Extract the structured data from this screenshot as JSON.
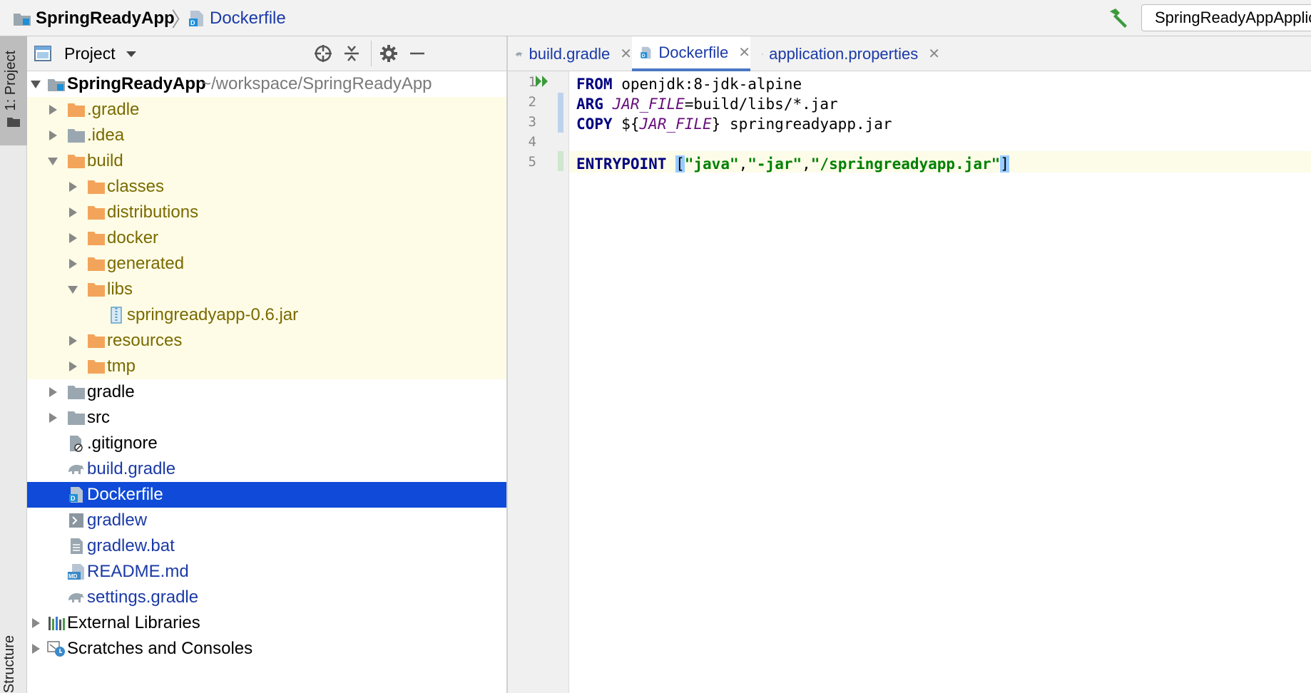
{
  "breadcrumb": {
    "project": "SpringReadyApp",
    "separator": "〉",
    "file": "Dockerfile"
  },
  "run_config": {
    "label": "SpringReadyAppApplication"
  },
  "left_stripe": {
    "project_tab": "1: Project",
    "bottom_tab": "Structure"
  },
  "project_panel": {
    "title": "Project",
    "icons": [
      "target-icon",
      "collapse-icon",
      "gear-icon",
      "minimize-icon"
    ]
  },
  "tree": {
    "root_name": "SpringReadyApp",
    "root_path": "~/workspace/SpringReadyApp",
    "items": [
      {
        "label": ".gradle"
      },
      {
        "label": ".idea"
      },
      {
        "label": "build"
      },
      {
        "label": "classes"
      },
      {
        "label": "distributions"
      },
      {
        "label": "docker"
      },
      {
        "label": "generated"
      },
      {
        "label": "libs"
      },
      {
        "label": "springreadyapp-0.6.jar"
      },
      {
        "label": "resources"
      },
      {
        "label": "tmp"
      },
      {
        "label": "gradle"
      },
      {
        "label": "src"
      },
      {
        "label": ".gitignore"
      },
      {
        "label": "build.gradle"
      },
      {
        "label": "Dockerfile"
      },
      {
        "label": "gradlew"
      },
      {
        "label": "gradlew.bat"
      },
      {
        "label": "README.md"
      },
      {
        "label": "settings.gradle"
      },
      {
        "label": "External Libraries"
      },
      {
        "label": "Scratches and Consoles"
      }
    ]
  },
  "editor_tabs": [
    {
      "label": "build.gradle",
      "close": "✕"
    },
    {
      "label": "Dockerfile",
      "close": "✕"
    },
    {
      "label": "application.properties",
      "close": "✕"
    }
  ],
  "editor": {
    "line_numbers": [
      "1",
      "2",
      "3",
      "4",
      "5"
    ],
    "line1": {
      "kw": "FROM",
      "rest": " openjdk:8-jdk-alpine"
    },
    "line2": {
      "kw": "ARG",
      "var": "JAR_FILE",
      "rest": "=build/libs/*.jar"
    },
    "line3": {
      "kw": "COPY",
      "pre": " ${",
      "var": "JAR_FILE",
      "post": "} springreadyapp.jar"
    },
    "line5": {
      "kw": "ENTRYPOINT",
      "open": "[",
      "s1": "\"java\"",
      "c1": ",",
      "s2": "\"-jar\"",
      "c2": ",",
      "s3": "\"/springreadyapp.jar\"",
      "close": "]"
    }
  }
}
